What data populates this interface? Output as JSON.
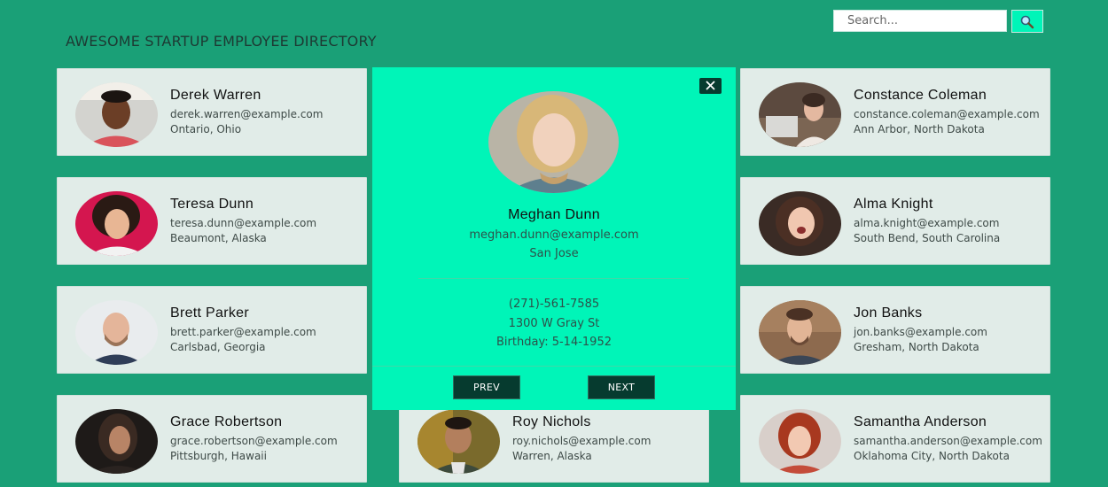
{
  "header": {
    "title": "AWESOME STARTUP EMPLOYEE DIRECTORY"
  },
  "search": {
    "placeholder": "Search..."
  },
  "employees": [
    {
      "name": "Derek Warren",
      "email": "derek.warren@example.com",
      "location": "Ontario, Ohio"
    },
    {
      "name": "Teresa Dunn",
      "email": "teresa.dunn@example.com",
      "location": "Beaumont, Alaska"
    },
    {
      "name": "Brett Parker",
      "email": "brett.parker@example.com",
      "location": "Carlsbad, Georgia"
    },
    {
      "name": "Grace Robertson",
      "email": "grace.robertson@example.com",
      "location": "Pittsburgh, Hawaii"
    },
    {
      "name": "Roy Nichols",
      "email": "roy.nichols@example.com",
      "location": "Warren, Alaska"
    },
    {
      "name": "Constance Coleman",
      "email": "constance.coleman@example.com",
      "location": "Ann Arbor, North Dakota"
    },
    {
      "name": "Alma Knight",
      "email": "alma.knight@example.com",
      "location": "South Bend, South Carolina"
    },
    {
      "name": "Jon Banks",
      "email": "jon.banks@example.com",
      "location": "Gresham, North Dakota"
    },
    {
      "name": "Samantha Anderson",
      "email": "samantha.anderson@example.com",
      "location": "Oklahoma City, North Dakota"
    }
  ],
  "modal": {
    "name": "Meghan Dunn",
    "email": "meghan.dunn@example.com",
    "city": "San Jose",
    "phone": "(271)-561-7585",
    "address": "1300 W Gray St",
    "birthday": "Birthday: 5-14-1952",
    "prev_label": "PREV",
    "next_label": "NEXT"
  },
  "colors": {
    "background": "#1aa077",
    "card": "#e1ece8",
    "modal": "#00f5b8",
    "button_dark": "#063b2f"
  }
}
